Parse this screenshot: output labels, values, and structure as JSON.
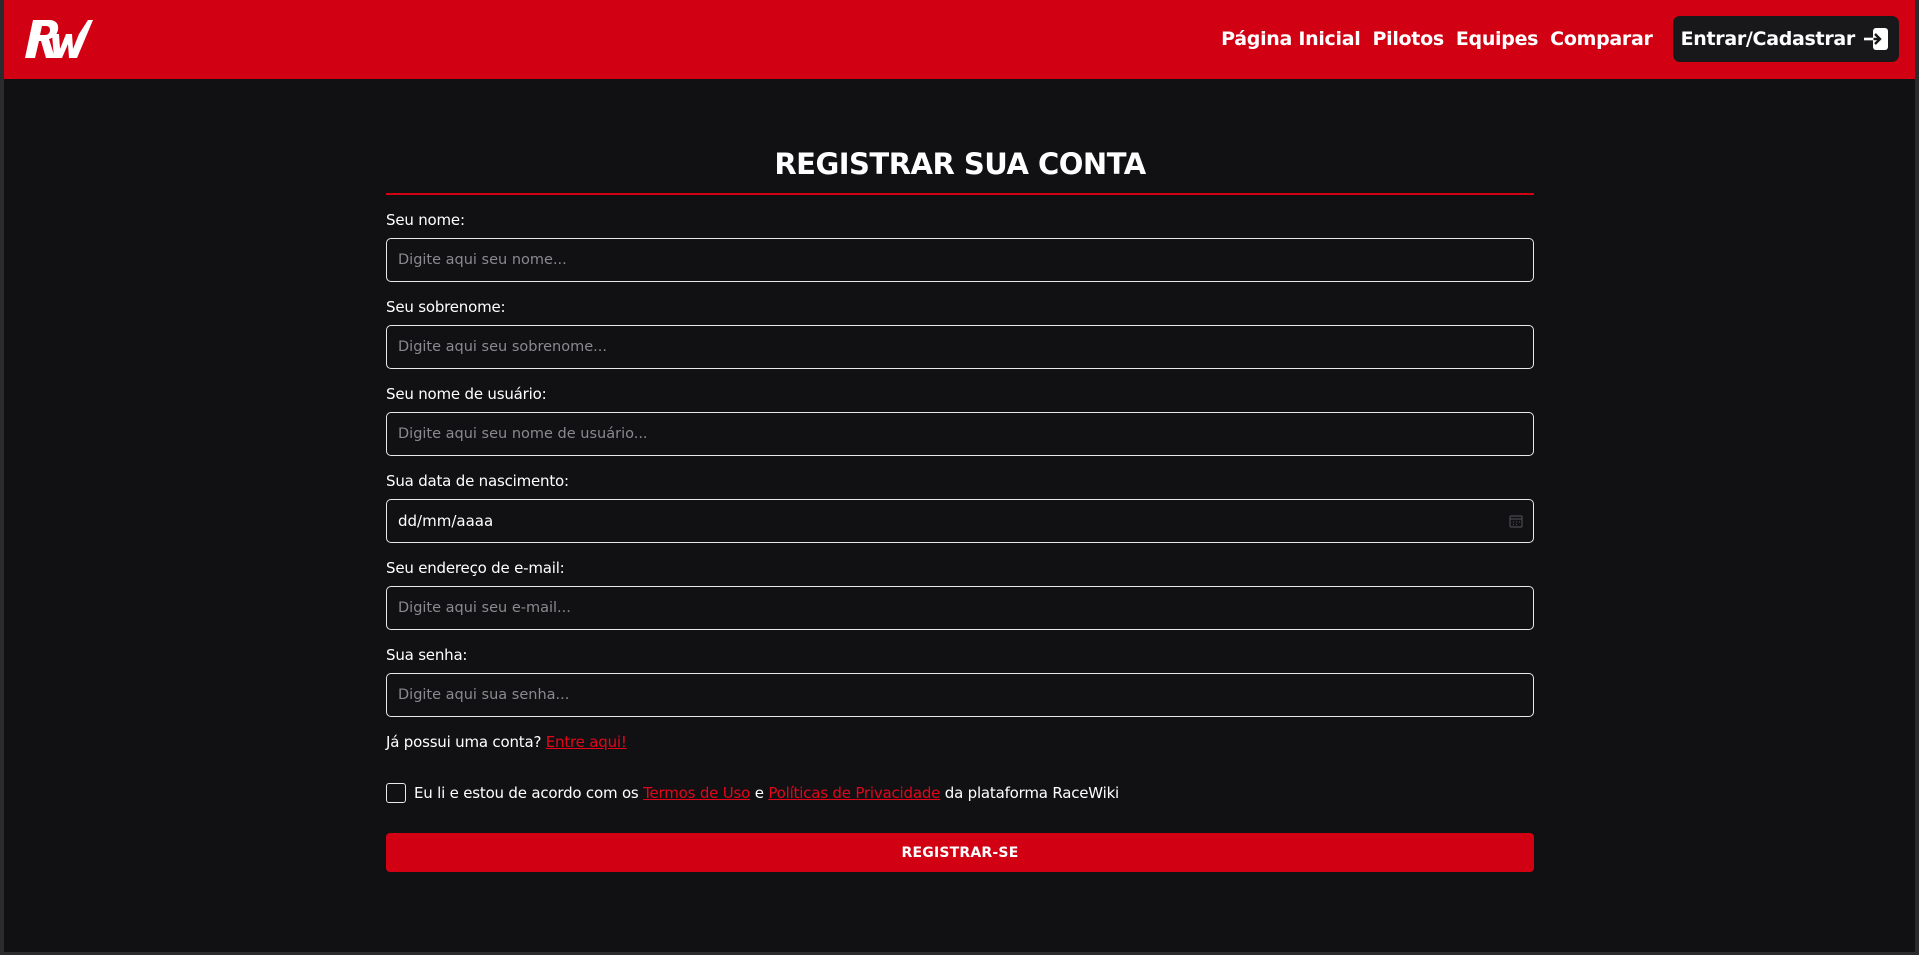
{
  "header": {
    "logo_text": "RW",
    "nav": [
      "Página Inicial",
      "Pilotos",
      "Equipes",
      "Comparar"
    ],
    "login_label": "Entrar/Cadastrar",
    "login_icon": "sign-in-icon",
    "accent_color": "#d10013"
  },
  "form": {
    "title": "REGISTRAR SUA CONTA",
    "fields": [
      {
        "label": "Seu nome:",
        "placeholder": "Digite aqui seu nome..."
      },
      {
        "label": "Seu sobrenome:",
        "placeholder": "Digite aqui seu sobrenome..."
      },
      {
        "label": "Seu nome de usuário:",
        "placeholder": "Digite aqui seu nome de usuário..."
      },
      {
        "label": "Sua data de nascimento:",
        "value": "dd/mm/aaaa",
        "icon": "calendar-icon"
      },
      {
        "label": "Seu endereço de e-mail:",
        "placeholder": "Digite aqui seu e-mail..."
      },
      {
        "label": "Sua senha:",
        "placeholder": "Digite aqui sua senha..."
      }
    ],
    "account_prompt": "Já possui uma conta?",
    "account_link": "Entre aqui!",
    "terms": {
      "prefix": "Eu li e estou de acordo com os",
      "terms_link": "Termos de Uso",
      "conjunction": "e",
      "privacy_link": "Políticas de Privacidade",
      "suffix": "da plataforma RaceWiki",
      "checked": false
    },
    "submit_label": "REGISTRAR-SE"
  }
}
